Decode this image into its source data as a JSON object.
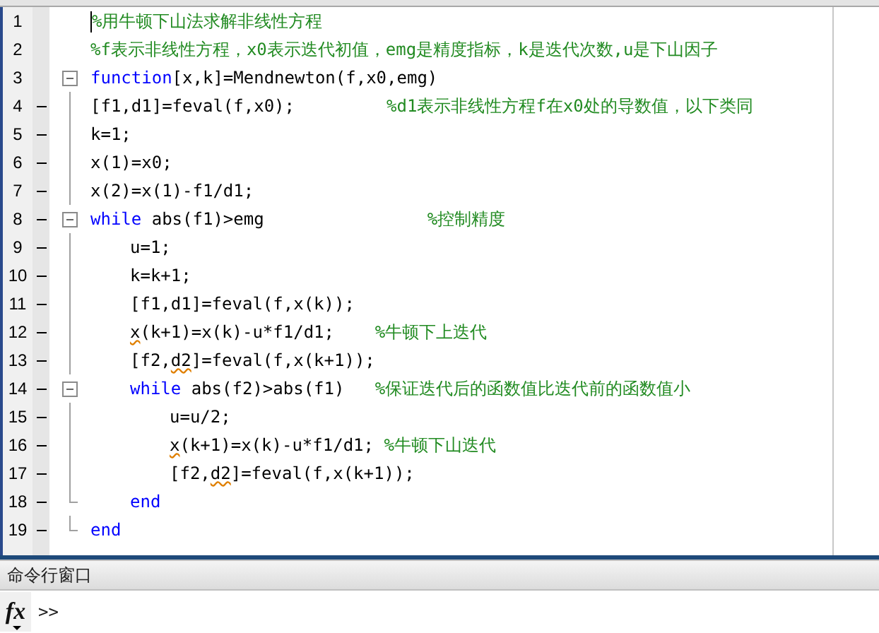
{
  "editor": {
    "lines": [
      {
        "number": "1",
        "kind": "line",
        "executable": false,
        "caret": true,
        "segments": [
          {
            "kind": "comment",
            "text": "%用牛顿下山法求解非线性方程"
          }
        ]
      },
      {
        "number": "2",
        "kind": "line",
        "executable": false,
        "caret": false,
        "segments": [
          {
            "kind": "comment",
            "text": "%f表示非线性方程，x0表示迭代初值，emg是精度指标，k是迭代次数,u是下山因子"
          }
        ]
      },
      {
        "number": "3",
        "kind": "block_start",
        "executable": false,
        "caret": false,
        "segments": [
          {
            "kind": "keyword",
            "text": "function"
          },
          {
            "kind": "code",
            "text": "[x,k]=Mendnewton(f,x0,emg)"
          }
        ]
      },
      {
        "number": "4",
        "kind": "line",
        "executable": true,
        "caret": false,
        "segments": [
          {
            "kind": "code",
            "text": "[f1,d1]=feval(f,x0);         "
          },
          {
            "kind": "comment",
            "text": "%d1表示非线性方程f在x0处的导数值，以下类同"
          }
        ]
      },
      {
        "number": "5",
        "kind": "line",
        "executable": true,
        "caret": false,
        "segments": [
          {
            "kind": "code",
            "text": "k=1;"
          }
        ]
      },
      {
        "number": "6",
        "kind": "line",
        "executable": true,
        "caret": false,
        "segments": [
          {
            "kind": "code",
            "text": "x(1)=x0;"
          }
        ]
      },
      {
        "number": "7",
        "kind": "line",
        "executable": true,
        "caret": false,
        "segments": [
          {
            "kind": "code",
            "text": "x(2)=x(1)-f1/d1;"
          }
        ]
      },
      {
        "number": "8",
        "kind": "block_start",
        "executable": true,
        "caret": false,
        "segments": [
          {
            "kind": "keyword",
            "text": "while"
          },
          {
            "kind": "code",
            "text": " abs(f1)>emg                "
          },
          {
            "kind": "comment",
            "text": "%控制精度"
          }
        ],
        "children": [
          {
            "number": "9",
            "kind": "line",
            "executable": true,
            "caret": false,
            "segments": [
              {
                "kind": "code",
                "text": "u=1;"
              }
            ]
          },
          {
            "number": "10",
            "kind": "line",
            "executable": true,
            "caret": false,
            "segments": [
              {
                "kind": "code",
                "text": "k=k+1;"
              }
            ]
          },
          {
            "number": "11",
            "kind": "line",
            "executable": true,
            "caret": false,
            "segments": [
              {
                "kind": "code",
                "text": "[f1,d1]=feval(f,x(k));"
              }
            ]
          },
          {
            "number": "12",
            "kind": "line",
            "executable": true,
            "caret": false,
            "segments": [
              {
                "kind": "warning",
                "text": "x"
              },
              {
                "kind": "code",
                "text": "(k+1)=x(k)-u*f1/d1;    "
              },
              {
                "kind": "comment",
                "text": "%牛顿下上迭代"
              }
            ]
          },
          {
            "number": "13",
            "kind": "line",
            "executable": true,
            "caret": false,
            "segments": [
              {
                "kind": "code",
                "text": "[f2,"
              },
              {
                "kind": "warning",
                "text": "d2"
              },
              {
                "kind": "code",
                "text": "]=feval(f,x(k+1));"
              }
            ]
          },
          {
            "number": "14",
            "kind": "block_start",
            "executable": true,
            "caret": false,
            "segments": [
              {
                "kind": "keyword",
                "text": "while"
              },
              {
                "kind": "code",
                "text": " abs(f2)>abs(f1)   "
              },
              {
                "kind": "comment",
                "text": "%保证迭代后的函数值比迭代前的函数值小"
              }
            ],
            "children": [
              {
                "number": "15",
                "kind": "line",
                "executable": true,
                "caret": false,
                "segments": [
                  {
                    "kind": "code",
                    "text": "u=u/2;"
                  }
                ]
              },
              {
                "number": "16",
                "kind": "line",
                "executable": true,
                "caret": false,
                "segments": [
                  {
                    "kind": "warning",
                    "text": "x"
                  },
                  {
                    "kind": "code",
                    "text": "(k+1)=x(k)-u*f1/d1; "
                  },
                  {
                    "kind": "comment",
                    "text": "%牛顿下山迭代"
                  }
                ]
              },
              {
                "number": "17",
                "kind": "line",
                "executable": true,
                "caret": false,
                "segments": [
                  {
                    "kind": "code",
                    "text": "[f2,"
                  },
                  {
                    "kind": "warning",
                    "text": "d2"
                  },
                  {
                    "kind": "code",
                    "text": "]=feval(f,x(k+1));"
                  }
                ]
              }
            ]
          },
          {
            "number": "18",
            "kind": "block_end",
            "executable": true,
            "caret": false,
            "segments": [
              {
                "kind": "keyword",
                "text": "end"
              }
            ]
          }
        ]
      },
      {
        "number": "19",
        "kind": "block_end",
        "executable": true,
        "caret": false,
        "segments": [
          {
            "kind": "keyword",
            "text": "end"
          }
        ]
      }
    ]
  },
  "command_window": {
    "title": "命令行窗口",
    "fx_button": "fx",
    "prompt": ">>"
  }
}
